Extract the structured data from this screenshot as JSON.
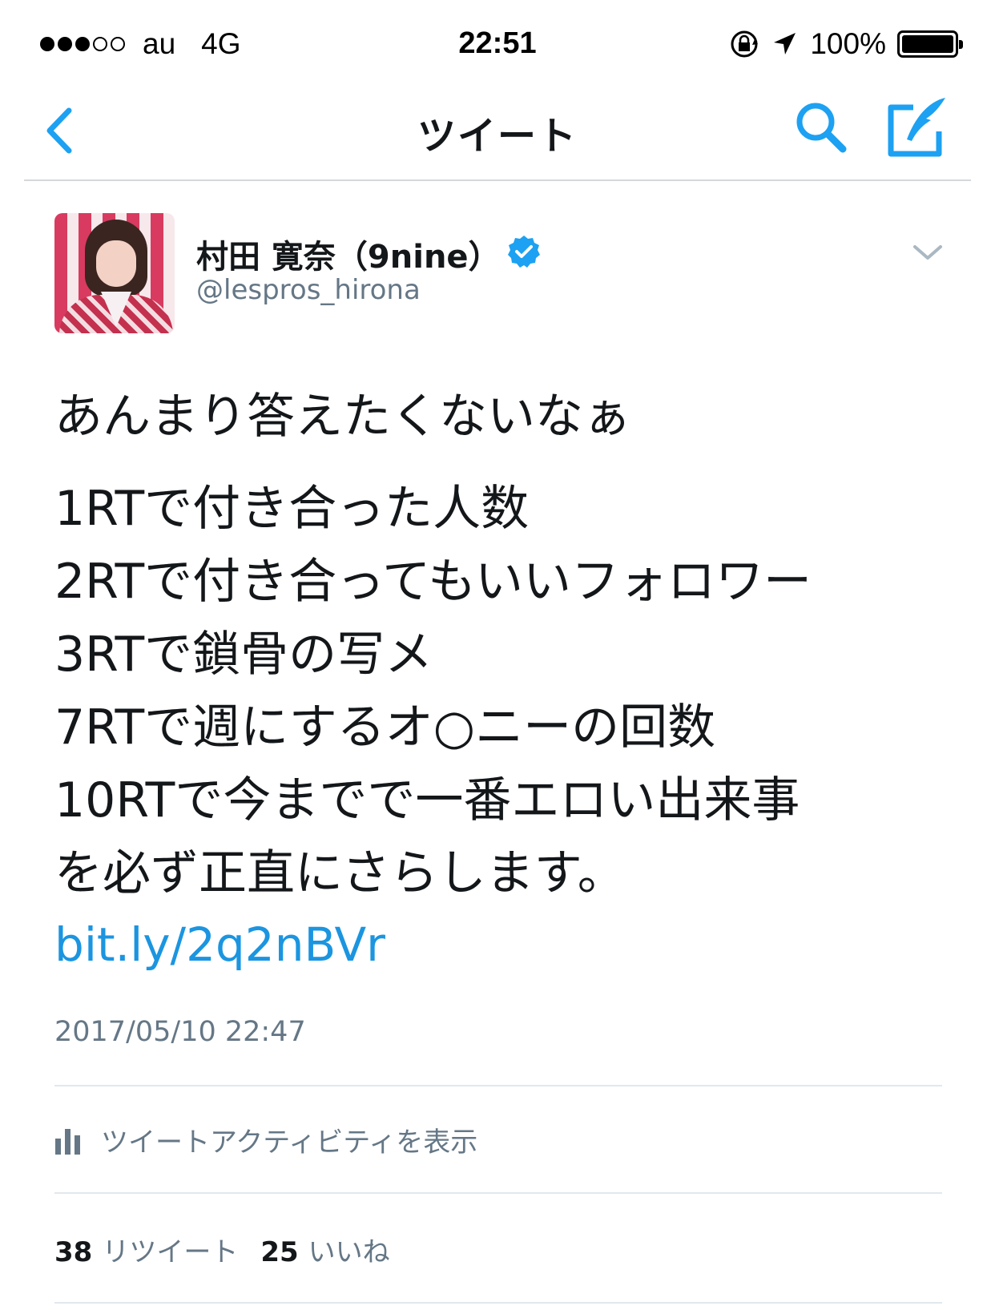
{
  "status_bar": {
    "carrier": "au",
    "network": "4G",
    "time": "22:51",
    "battery": "100%",
    "signal_filled": 3,
    "signal_total": 5
  },
  "nav": {
    "title": "ツイート",
    "back_icon": "chevron-left-icon",
    "search_icon": "search-icon",
    "compose_icon": "compose-tweet-icon",
    "accent": "#1da1f2"
  },
  "tweet": {
    "display_name": "村田 寛奈（9nine）",
    "screen_name": "@lespros_hirona",
    "verified": true,
    "lines": [
      "あんまり答えたくないなぁ",
      "1RTで付き合った人数",
      "2RTで付き合ってもいいフォロワー",
      "3RTで鎖骨の写メ",
      "7RTで週にするオ○ニーの回数",
      "10RTで今までで一番エロい出来事",
      "を必ず正直にさらします。"
    ],
    "link": "bit.ly/2q2nBVr",
    "timestamp": "2017/05/10 22:47",
    "link_color": "#1b95e0"
  },
  "activity": {
    "label": "ツイートアクティビティを表示",
    "icon": "bar-chart-icon"
  },
  "stats": {
    "retweet_count": "38",
    "retweet_label": "リツイート",
    "like_count": "25",
    "like_label": "いいね"
  }
}
